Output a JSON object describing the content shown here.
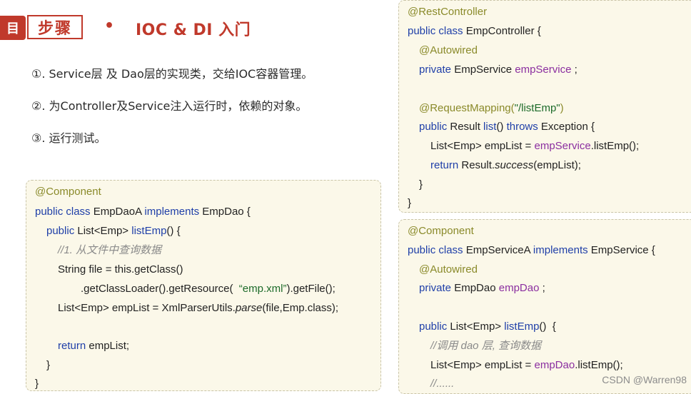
{
  "header": {
    "icon_glyph": "目",
    "section_label": "步骤",
    "bullet": "•",
    "title": "IOC & DI 入门",
    "accent_color": "#c0392b"
  },
  "steps": [
    "①. Service层 及 Dao层的实现类，交给IOC容器管理。",
    "②. 为Controller及Service注入运行时，依赖的对象。",
    "③. 运行测试。"
  ],
  "dao_code": {
    "l1": "@Component",
    "l2": {
      "a": "public class ",
      "b": "EmpDaoA ",
      "c": "implements ",
      "d": "EmpDao {"
    },
    "l3": {
      "a": "public ",
      "b": "List<Emp> ",
      "c": "listEmp",
      "d": "() {"
    },
    "l4": "//1. 从文件中查询数据",
    "l5": "String file = this.getClass()",
    "l6": {
      "a": ".getClassLoader().getResource(  ",
      "b": "“emp.xml”",
      "c": ").getFile();"
    },
    "l7": {
      "a": "List<Emp> empList = XmlParserUtils.",
      "b": "parse",
      "c": "(file,Emp.class);"
    },
    "l8": {
      "a": "return ",
      "b": "empList;"
    },
    "l9": "}",
    "l10": "}"
  },
  "controller_code": {
    "l1": "@RestController",
    "l2": {
      "a": "public class ",
      "b": "EmpController {"
    },
    "l3": "@Autowired",
    "l4": {
      "a": "private ",
      "b": "EmpService ",
      "c": "empService",
      "d": " ;"
    },
    "l5": {
      "a": "@RequestMapping(",
      "b": "\"/listEmp\"",
      "c": ")"
    },
    "l6": {
      "a": "public ",
      "b": "Result ",
      "c": "list",
      "d": "() ",
      "e": "throws ",
      "f": "Exception {"
    },
    "l7": {
      "a": "List<Emp> empList = ",
      "b": "empService",
      ".c": "",
      "c": ".listEmp();"
    },
    "l8": {
      "a": "return ",
      "b": "Result.",
      "c": "success",
      "d": "(empList);"
    },
    "l9": "}",
    "l10": "}"
  },
  "service_code": {
    "l1": "@Component",
    "l2": {
      "a": "public class ",
      "b": "EmpServiceA ",
      "c": "implements ",
      "d": "EmpService {"
    },
    "l3": "@Autowired",
    "l4": {
      "a": "private ",
      "b": "EmpDao ",
      "c": "empDao",
      "d": " ;"
    },
    "l5": {
      "a": "public ",
      "b": "List<Emp> ",
      "c": "listEmp",
      "d": "()  {"
    },
    "l6": "//调用 dao 层, 查询数据",
    "l7": {
      "a": "List<Emp> empList = ",
      "b": "empDao",
      ".c": "",
      "c": ".listEmp();"
    },
    "l8": "//......"
  },
  "watermark": "CSDN @Warren98"
}
